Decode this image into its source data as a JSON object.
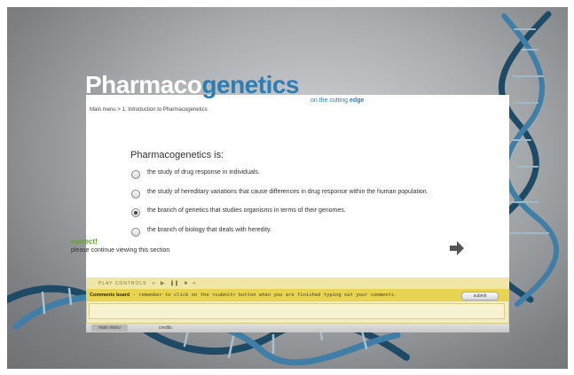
{
  "app": {
    "title_part1": "Pharmaco",
    "title_part2": "genetics",
    "tagline_prefix": "on the cutting ",
    "tagline_bold": "edge"
  },
  "breadcrumb": "Main menu  >  1. Introduction to Pharmacogenetics",
  "quiz": {
    "question": "Pharmacogenetics is:",
    "options": [
      {
        "label": "the study of drug response in individuals.",
        "selected": false
      },
      {
        "label": "the study of hereditary variations that cause differences in drug response within the human population.",
        "selected": false
      },
      {
        "label": "the branch of genetics that studies organisms in terms of their genomes.",
        "selected": true
      },
      {
        "label": "the branch of biology that deals with heredity.",
        "selected": false
      }
    ],
    "feedback_title": "correct!",
    "feedback_message": "please continue viewing this section"
  },
  "controls": {
    "label": "PLAY CONTROLS",
    "rewind": "«",
    "play": "▶",
    "pause": "❚❚",
    "stop": "■",
    "forward": "»"
  },
  "comments": {
    "title": "Comments board",
    "instruction": " - remember to click on the <submit> button when you are finished typing out your comments.",
    "submit_label": "submit",
    "value": ""
  },
  "nav": {
    "main_menu": "main menu",
    "credits": "credits"
  },
  "colors": {
    "accent": "#2d7db5",
    "correct": "#5aa620",
    "comments_bar": "#e8d450"
  }
}
